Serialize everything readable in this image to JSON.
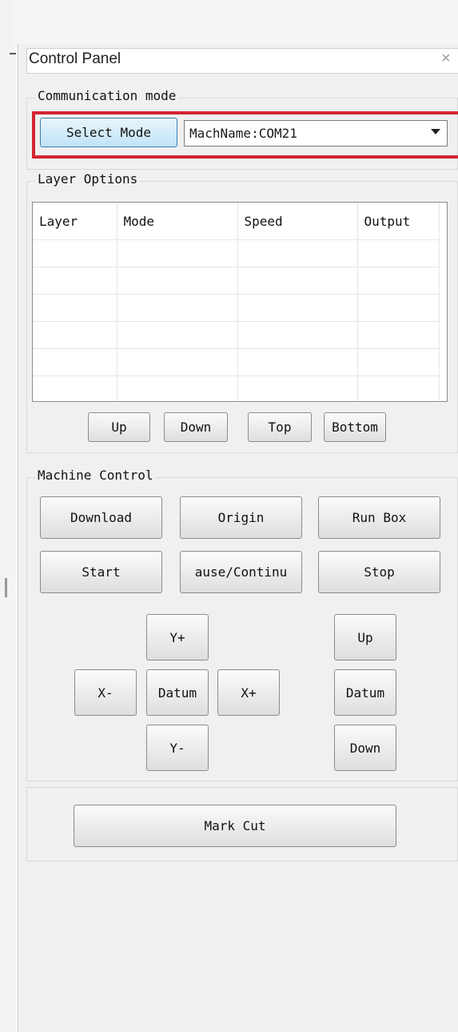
{
  "panel": {
    "title": "Control Panel",
    "close_glyph": "×"
  },
  "communication": {
    "legend": "Communication mode",
    "select_mode_label": "Select Mode",
    "mach_name_value": "MachName:COM21"
  },
  "layer_options": {
    "legend": "Layer Options",
    "columns": [
      "Layer",
      "Mode",
      "Speed",
      "Output"
    ],
    "rows": [
      [
        "",
        "",
        "",
        ""
      ],
      [
        "",
        "",
        "",
        ""
      ],
      [
        "",
        "",
        "",
        ""
      ],
      [
        "",
        "",
        "",
        ""
      ],
      [
        "",
        "",
        "",
        ""
      ],
      [
        "",
        "",
        "",
        ""
      ]
    ],
    "buttons": {
      "up": "Up",
      "down": "Down",
      "top": "Top",
      "bottom": "Bottom"
    }
  },
  "machine_control": {
    "legend": "Machine Control",
    "download": "Download",
    "origin": "Origin",
    "run_box": "Run Box",
    "start": "Start",
    "pause_continue": "ause/Continu",
    "stop": "Stop",
    "y_plus": "Y+",
    "y_minus": "Y-",
    "x_minus": "X-",
    "x_plus": "X+",
    "datum_xy": "Datum",
    "z_up": "Up",
    "z_datum": "Datum",
    "z_down": "Down"
  },
  "mark_cut": {
    "label": "Mark Cut"
  },
  "colors": {
    "highlight_border": "#d22532",
    "selected_button": "#bfe3f6"
  }
}
